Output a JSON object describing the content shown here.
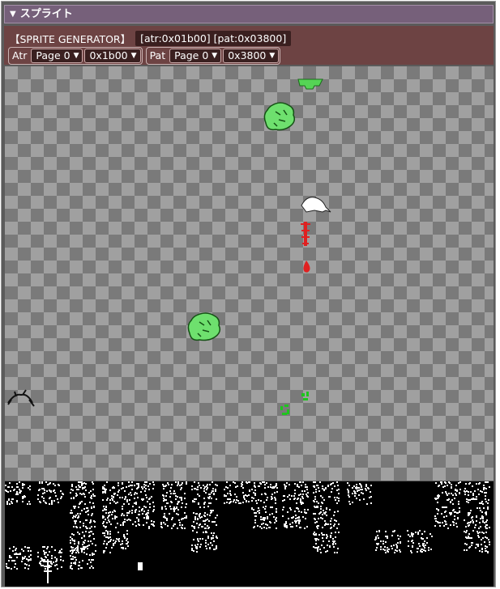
{
  "panel": {
    "title": "スプライト"
  },
  "toolbar": {
    "generator_label": "【SPRITE GENERATOR】",
    "address_label": "[atr:0x01b00] [pat:0x03800]",
    "atr": {
      "tag": "Atr",
      "page": "Page 0",
      "address": "0x1b00"
    },
    "pat": {
      "tag": "Pat",
      "page": "Page 0",
      "address": "0x3800"
    }
  },
  "icons": {
    "collapse": "triangle-down-icon",
    "dropdown": "chevron-down-icon"
  },
  "colors": {
    "title_bg": "#76607a",
    "toolbar_bg": "#6d4343",
    "sprite_green": "#55d455",
    "sprite_red": "#e02020",
    "sprite_white": "#ffffff"
  }
}
